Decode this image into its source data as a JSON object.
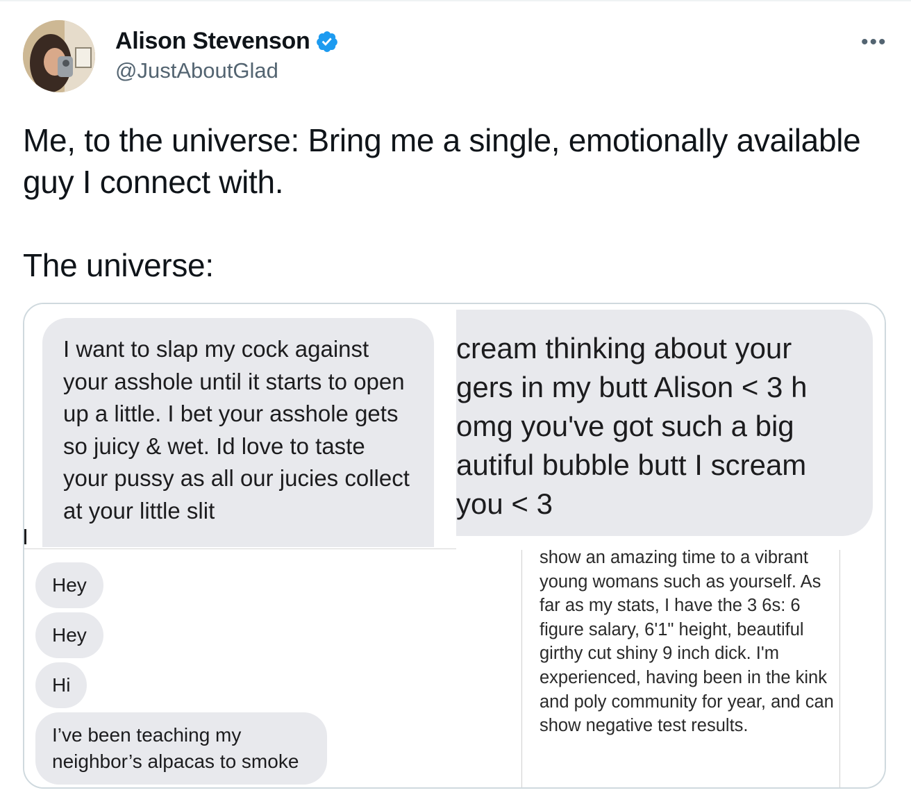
{
  "tweet": {
    "display_name": "Alison Stevenson",
    "handle": "@JustAboutGlad",
    "more_icon": "more-icon",
    "verified_icon": "verified-badge-icon",
    "text": "Me, to the universe: Bring me a single, emotionally available guy I connect with.\n\nThe universe:",
    "accent_color": "#1d9bf0"
  },
  "media": {
    "panel1": {
      "message": "I want to slap my cock against your asshole until it starts to open up a little. I bet your asshole gets so juicy & wet. Id love to taste your pussy as all our jucies collect at your little slit"
    },
    "panel2": {
      "message": "cream thinking about your gers in my butt Alison < 3 h omg you've got such a big autiful bubble butt I scream you < 3"
    },
    "panel3": {
      "messages": [
        "Hey",
        "Hey",
        "Hi",
        "I’ve been teaching my neighbor’s alpacas to smoke"
      ]
    },
    "panel4": {
      "message": "show an amazing time to a vibrant young womans such as yourself. As far as my stats, I have the 3 6s: 6 figure salary, 6'1\" height, beautiful girthy cut shiny 9 inch dick. I'm experienced, having been in the kink and poly community for year, and can show negative test results."
    }
  }
}
